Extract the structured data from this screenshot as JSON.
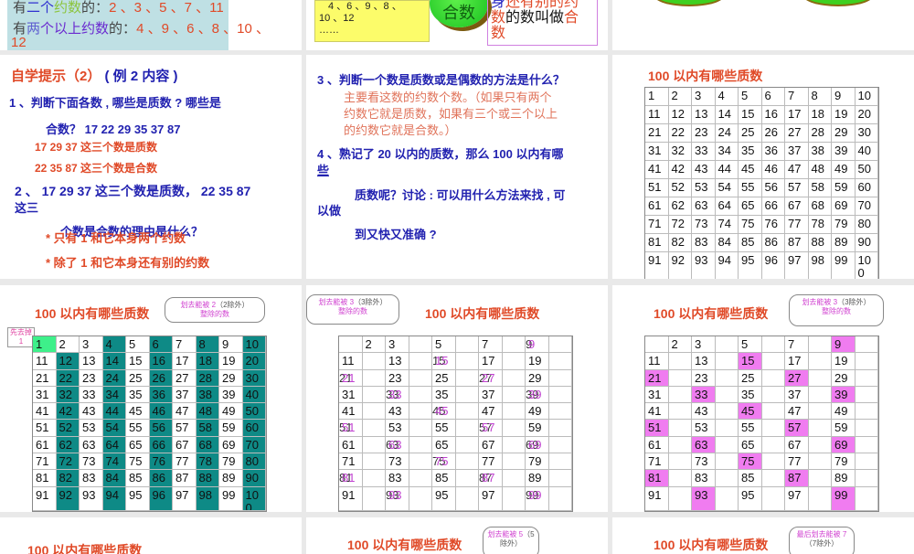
{
  "slide1": {
    "line1": {
      "a": "有",
      "b": "二个",
      "c": "约数",
      "d": "的：",
      "nums": "2 、3 、5 、7 、11"
    },
    "line2": {
      "a": "有",
      "b": "两",
      "c": "个以上约数",
      "d": "的：",
      "nums": "4 、9 、6 、8 、10 、",
      "wrap": "12"
    }
  },
  "slide2": {
    "yellow": [
      "4 、6 、9 、8 、",
      "10 、12",
      "……"
    ],
    "circle": "合数",
    "def": {
      "l1a": "身",
      "l1b": "还有别的约",
      "l2a": "数",
      "l2b": "的数叫做",
      "l2c": "合",
      "l3": "数"
    }
  },
  "slide4": {
    "title_a": "自学提示（2）",
    "title_b": "( 例 2 内容 )",
    "q1": "1 、判断下面各数 , 哪些是质数 ? 哪些是",
    "q1b": "合数？ 17    22    29    35    37   87",
    "a1": "17   29   37 这三个数是质数",
    "a2": "22  35   87 这三个数是合数",
    "q2": "2 、 17  29  37 这三个数是质数，   22  35  87",
    "q2b": "这三",
    "q2c": "个数是合数的理由是什么？",
    "r1": "* 只有    1 和它本身两个约数",
    "r2": "* 除了 1 和它本身还有别的约数"
  },
  "slide5": {
    "q3": "3 、判断一个数是质数或是偶数的方法是什么？",
    "a3": [
      "主要看这数的约数个数。（如果只有两个",
      "约数它就是质数，如果有三个或三个以上",
      "的约数它就是合数。）"
    ],
    "q4": "4 、熟记了 20 以内的质数，那么 100 以内有哪",
    "q4b": "些",
    "q4c": "质数呢？讨论 : 可以用什么方法来找 , 可",
    "q4d": "以做",
    "q4e": "到又快又准确 ?"
  },
  "grid_title": "100 以内有哪些质数",
  "slide7": {
    "remove1": "先去掉1",
    "callout_a": "划去能被 2",
    "callout_b": "（2除外）",
    "callout_c": "整除的数"
  },
  "slide8": {
    "callout_a": "划去能被 3",
    "callout_b": "（3除外）",
    "callout_c": "整除的数"
  },
  "slide9": {
    "callout_a": "划去能被 3",
    "callout_b": "（3除外）",
    "callout_c": "整除的数"
  },
  "slide11": {
    "callout_a": "划去能被 5",
    "callout_b": "（5除外）"
  },
  "slide12": {
    "callout_a": "最后划去能被 7",
    "callout_b": "（7除外）"
  },
  "numbers": [
    "1",
    "2",
    "3",
    "4",
    "5",
    "6",
    "7",
    "8",
    "9",
    "10",
    "11",
    "12",
    "13",
    "14",
    "15",
    "16",
    "17",
    "18",
    "19",
    "20",
    "21",
    "22",
    "23",
    "24",
    "25",
    "26",
    "27",
    "28",
    "29",
    "30",
    "31",
    "32",
    "33",
    "34",
    "35",
    "36",
    "37",
    "38",
    "39",
    "40",
    "41",
    "42",
    "43",
    "44",
    "45",
    "46",
    "47",
    "48",
    "49",
    "50",
    "51",
    "52",
    "53",
    "54",
    "55",
    "56",
    "57",
    "58",
    "59",
    "60",
    "61",
    "62",
    "63",
    "64",
    "65",
    "66",
    "67",
    "68",
    "69",
    "70",
    "71",
    "72",
    "73",
    "74",
    "75",
    "76",
    "77",
    "78",
    "79",
    "80",
    "81",
    "82",
    "83",
    "84",
    "85",
    "86",
    "87",
    "88",
    "89",
    "90",
    "91",
    "92",
    "93",
    "94",
    "95",
    "96",
    "97",
    "98",
    "99",
    "100"
  ],
  "colors": {
    "teal": "#0e8a86",
    "pink": "#f07cf0",
    "green": "#3ef08a",
    "title": "#e04a28"
  }
}
